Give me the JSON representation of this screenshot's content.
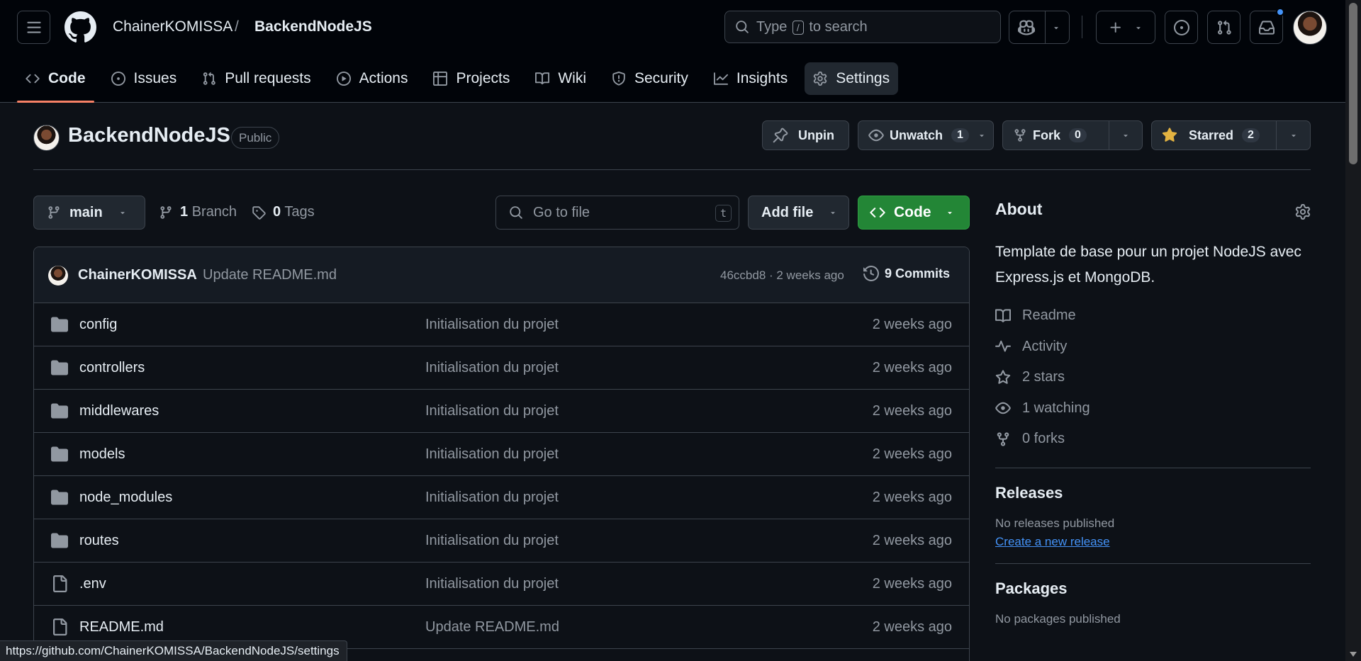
{
  "header": {
    "owner": "ChainerKOMISSA",
    "separator": "/",
    "repo": "BackendNodeJS",
    "search": {
      "type_label": "Type",
      "kbd": "/",
      "suffix": "to search"
    }
  },
  "repo_nav": [
    {
      "label": "Code",
      "icon": "code-icon",
      "active": true
    },
    {
      "label": "Issues",
      "icon": "issue-icon"
    },
    {
      "label": "Pull requests",
      "icon": "pull-request-icon"
    },
    {
      "label": "Actions",
      "icon": "play-icon"
    },
    {
      "label": "Projects",
      "icon": "table-icon"
    },
    {
      "label": "Wiki",
      "icon": "book-icon"
    },
    {
      "label": "Security",
      "icon": "shield-icon"
    },
    {
      "label": "Insights",
      "icon": "graph-icon"
    },
    {
      "label": "Settings",
      "icon": "gear-icon"
    }
  ],
  "repo_header": {
    "name": "BackendNodeJS",
    "visibility": "Public",
    "unpin_label": "Unpin",
    "watch_label": "Unwatch",
    "watch_count": "1",
    "fork_label": "Fork",
    "fork_count": "0",
    "star_label": "Starred",
    "star_count": "2"
  },
  "toolbar": {
    "branch": "main",
    "branches_count": "1",
    "branches_label": "Branch",
    "tags_count": "0",
    "tags_label": "Tags",
    "goto_placeholder": "Go to file",
    "goto_kbd": "t",
    "add_file_label": "Add file",
    "code_label": "Code"
  },
  "latest_commit": {
    "author": "ChainerKOMISSA",
    "message": "Update README.md",
    "meta": "46ccbd8 · 2 weeks ago",
    "commits_label": "9 Commits"
  },
  "files": [
    {
      "name": "config",
      "type": "dir",
      "message": "Initialisation du projet",
      "age": "2 weeks ago"
    },
    {
      "name": "controllers",
      "type": "dir",
      "message": "Initialisation du projet",
      "age": "2 weeks ago"
    },
    {
      "name": "middlewares",
      "type": "dir",
      "message": "Initialisation du projet",
      "age": "2 weeks ago"
    },
    {
      "name": "models",
      "type": "dir",
      "message": "Initialisation du projet",
      "age": "2 weeks ago"
    },
    {
      "name": "node_modules",
      "type": "dir",
      "message": "Initialisation du projet",
      "age": "2 weeks ago"
    },
    {
      "name": "routes",
      "type": "dir",
      "message": "Initialisation du projet",
      "age": "2 weeks ago"
    },
    {
      "name": ".env",
      "type": "file",
      "message": "Initialisation du projet",
      "age": "2 weeks ago"
    },
    {
      "name": "README.md",
      "type": "file",
      "message": "Update README.md",
      "age": "2 weeks ago"
    }
  ],
  "about": {
    "title": "About",
    "description": "Template de base pour un projet NodeJS avec Express.js et MongoDB.",
    "links": [
      {
        "label": "Readme",
        "icon": "book-icon"
      },
      {
        "label": "Activity",
        "icon": "pulse-icon"
      },
      {
        "label": "2 stars",
        "icon": "star-icon"
      },
      {
        "label": "1 watching",
        "icon": "eye-icon"
      },
      {
        "label": "0 forks",
        "icon": "fork-icon"
      }
    ]
  },
  "releases": {
    "title": "Releases",
    "empty_text": "No releases published",
    "create_link": "Create a new release"
  },
  "packages": {
    "title": "Packages",
    "empty_text": "No packages published"
  },
  "status_url": "https://github.com/ChainerKOMISSA/BackendNodeJS/settings",
  "colors": {
    "background": "#0d1117",
    "header_bg": "#010409",
    "border": "#3d444d",
    "accent_green": "#238636",
    "link_blue": "#4493f8",
    "active_tab_underline": "#f78166",
    "star_yellow": "#e3b341"
  }
}
